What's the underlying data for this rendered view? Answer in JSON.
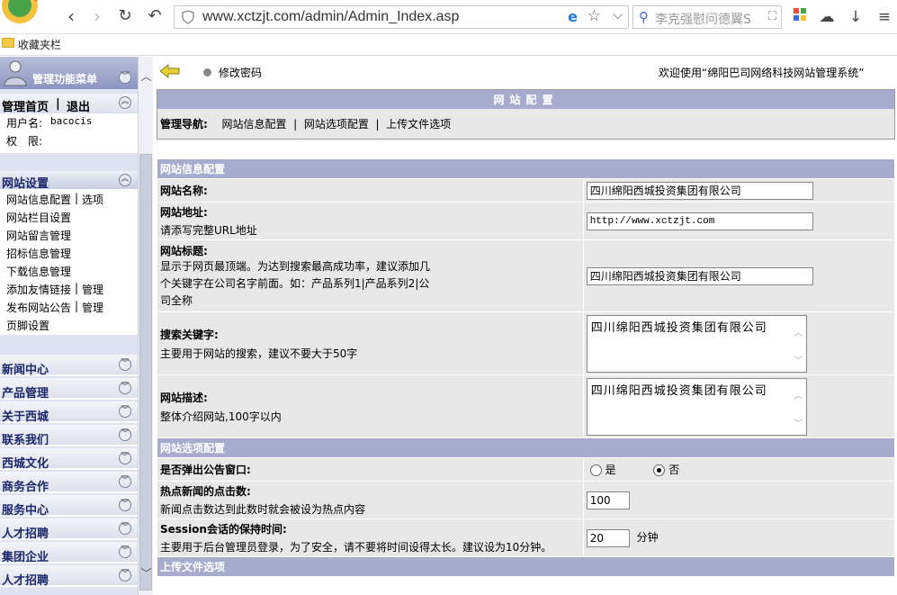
{
  "browser": {
    "url": "www.xctzjt.com/admin/Admin_Index.asp",
    "search_placeholder": "李克强慰问德翼S",
    "favorites_label": "收藏夹栏"
  },
  "sidebar": {
    "menu_title": "管理功能菜单",
    "home_label": "管理首页",
    "sep": "|",
    "logout_label": "退出",
    "username_label": "用户名:",
    "username": "bacocis",
    "permission_label": "权　限:",
    "site_section": "网站设置",
    "site_items": [
      "网站信息配置",
      "网站栏目设置",
      "网站留言管理",
      "招标信息管理",
      "下载信息管理",
      "添加友情链接",
      "发布网站公告",
      "页脚设置"
    ],
    "site_extra": {
      "options": "选项",
      "manage1": "管理",
      "manage2": "管理"
    },
    "categories": [
      "新闻中心",
      "产品管理",
      "关于西城",
      "联系我们",
      "西城文化",
      "商务合作",
      "服务中心",
      "人才招聘",
      "集团企业",
      "人才招聘"
    ]
  },
  "main": {
    "change_password": "修改密码",
    "welcome": "欢迎使用“绵阳巴司网络科技网站管理系统”",
    "panel_title": "网站配置",
    "nav_caption": "管理导航:",
    "nav_links": [
      "网站信息配置",
      "网站选项配置",
      "上传文件选项"
    ],
    "section_info": "网站信息配置",
    "fields": [
      {
        "label": "网站名称:",
        "hint": "",
        "value": "四川绵阳西城投资集团有限公司"
      },
      {
        "label": "网站地址:",
        "hint": "请添写完整URL地址",
        "value": "http://www.xctzjt.com"
      },
      {
        "label": "网站标题:",
        "hint": "显示于网页最顶端。为达到搜索最高成功率，建议添加几个关键字在公司名字前面。如：产品系列1|产品系列2|公司全称",
        "value": "四川绵阳西城投资集团有限公司"
      },
      {
        "label": "搜索关键字:",
        "hint": "主要用于网站的搜索，建议不要大于50字",
        "value": "四川绵阳西城投资集团有限公司"
      },
      {
        "label": "网站描述:",
        "hint": "整体介绍网站,100字以内",
        "value": "四川绵阳西城投资集团有限公司"
      }
    ],
    "section_options": "网站选项配置",
    "popup": {
      "label": "是否弹出公告窗口:",
      "yes": "是",
      "no": "否"
    },
    "hot": {
      "label": "热点新闻的点击数:",
      "hint": "新闻点击数达到此数时就会被设为热点内容",
      "value": "100"
    },
    "session": {
      "label": "Session会话的保持时间:",
      "hint": "主要用于后台管理员登录，为了安全，请不要将时间设得太长。建议设为10分钟。",
      "value": "20",
      "unit": "分钟"
    },
    "section_upload": "上传文件选项"
  }
}
